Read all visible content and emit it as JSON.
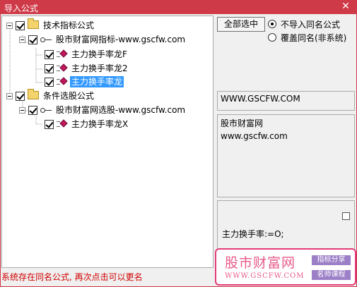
{
  "window": {
    "title": "导入公式",
    "close_glyph": "✕"
  },
  "tree": {
    "groups": [
      {
        "label": "技术指标公式",
        "package": "股市财富网指标-www.gscfw.com",
        "items": [
          "主力换手率龙F",
          "主力换手率龙2",
          "主力换手率龙"
        ]
      },
      {
        "label": "条件选股公式",
        "package": "股市财富网选股-www.gscfw.com",
        "items": [
          "主力换手率龙X"
        ]
      }
    ],
    "selected_item": "主力换手率龙"
  },
  "controls": {
    "select_all_label": "全部选中",
    "radio_skip_label": "不导入同名公式",
    "radio_overwrite_label": "覆盖同名(非系统)",
    "selected_radio": "不导入同名公式"
  },
  "info": {
    "url": "WWW.GSCFW.COM",
    "desc_line1": "股市财富网",
    "desc_line2": "www.gscfw.com",
    "formula": "主力换手率:=O;"
  },
  "status_text": "系统存在同名公式, 再次点击可以更名",
  "logo": {
    "main": "股市财富网",
    "url": "WWW.GSCFW.COM",
    "tag1": "指标分享",
    "tag2": "名师课程"
  },
  "colors": {
    "title_bar": "#cf3a48",
    "selection": "#3399ff",
    "status": "#d00000",
    "logo_accent": "#e33b79"
  }
}
